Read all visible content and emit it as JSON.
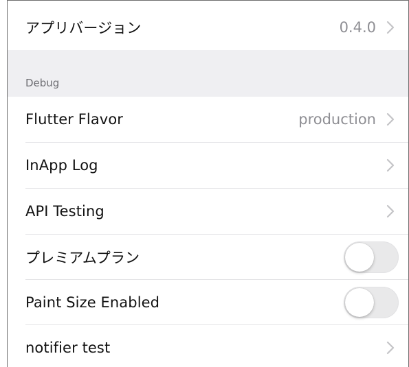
{
  "rows": {
    "app_version": {
      "label": "アプリバージョン",
      "value": "0.4.0"
    },
    "flutter_flavor": {
      "label": "Flutter Flavor",
      "value": "production"
    },
    "inapp_log": {
      "label": "InApp Log"
    },
    "api_testing": {
      "label": "API Testing"
    },
    "premium_plan": {
      "label": "プレミアムプラン",
      "toggle_on": false
    },
    "paint_size_enabled": {
      "label": "Paint Size Enabled",
      "toggle_on": false
    },
    "notifier_test": {
      "label": "notifier test"
    }
  },
  "sections": {
    "debug": {
      "header": "Debug"
    }
  },
  "icons": {
    "disclosure": "chevron-right-icon"
  },
  "colors": {
    "label": "#111111",
    "secondary": "#8e8e93",
    "section_background": "#efeff2",
    "toggle_off": "#e9e9ea"
  }
}
